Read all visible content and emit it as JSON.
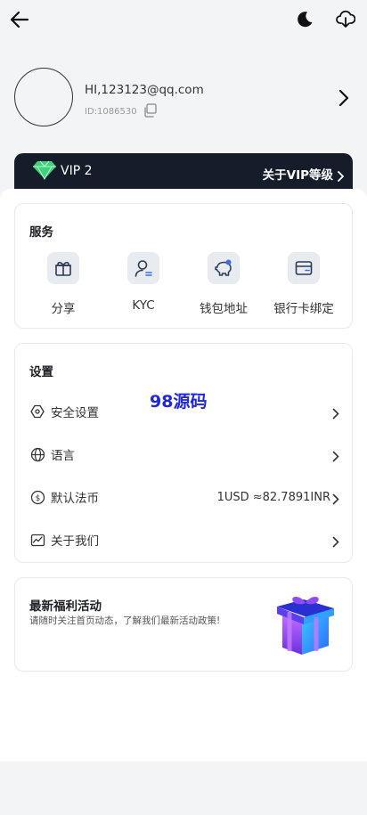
{
  "topbar": {
    "back_icon": "arrow-left-icon",
    "theme_icon": "moon-icon",
    "download_icon": "cloud-download-icon"
  },
  "profile": {
    "email": "HI,123123@qq.com",
    "id": "ID:1086530"
  },
  "vip": {
    "level": "VIP 2",
    "about": "关于VIP等级"
  },
  "services": {
    "title": "服务",
    "items": [
      {
        "label": "分享",
        "icon": "gift-icon"
      },
      {
        "label": "KYC",
        "icon": "user-id-icon"
      },
      {
        "label": "钱包地址",
        "icon": "piggy-bank-icon"
      },
      {
        "label": "银行卡绑定",
        "icon": "card-icon"
      }
    ]
  },
  "settings": {
    "title": "设置",
    "items": [
      {
        "label": "安全设置",
        "value": ""
      },
      {
        "label": "语言",
        "value": ""
      },
      {
        "label": "默认法币",
        "value": "1USD ≈82.7891INR"
      },
      {
        "label": "关于我们",
        "value": ""
      }
    ]
  },
  "watermark": "98源码",
  "promo": {
    "title": "最新福利活动",
    "subtitle": "请随时关注首页动态，了解我们最新活动政策!"
  },
  "colors": {
    "vip_bg": "#161d2a",
    "accent": "#1f27d8",
    "icon_bg": "#e8ebf0"
  }
}
